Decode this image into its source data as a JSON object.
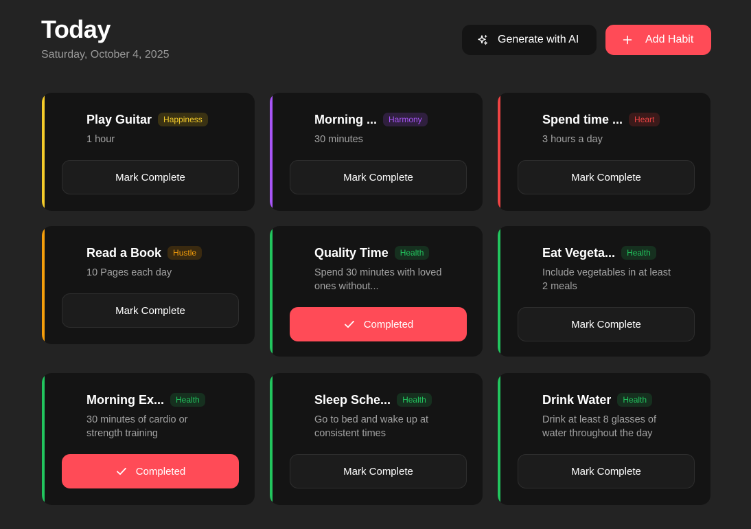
{
  "header": {
    "title": "Today",
    "date": "Saturday, October 4, 2025"
  },
  "actions": {
    "ai_label": "Generate with AI",
    "ai_icon": "sparkles-icon",
    "add_label": "Add Habit",
    "add_icon": "plus-icon"
  },
  "colors": {
    "background": "#232323",
    "card": "#141414",
    "accent_red": "#ff4b57",
    "happiness": "#f5cc2a",
    "harmony": "#a855f7",
    "heart": "#ef4444",
    "hustle": "#f59e0b",
    "health": "#22c55e"
  },
  "habits": [
    {
      "title": "Play Guitar",
      "category": "Happiness",
      "description": "1 hour",
      "status": "Mark Complete"
    },
    {
      "title": "Morning ...",
      "category": "Harmony",
      "description": "30 minutes",
      "status": "Mark Complete"
    },
    {
      "title": "Spend time ...",
      "category": "Heart",
      "description": "3 hours a day",
      "status": "Mark Complete"
    },
    {
      "title": "Read a Book",
      "category": "Hustle",
      "description": "10 Pages each day",
      "status": "Mark Complete"
    },
    {
      "title": "Quality Time",
      "category": "Health",
      "description": "Spend 30 minutes with loved ones without...",
      "status": "Completed"
    },
    {
      "title": "Eat Vegeta...",
      "category": "Health",
      "description": "Include vegetables in at least 2 meals",
      "status": "Mark Complete"
    },
    {
      "title": "Morning Ex...",
      "category": "Health",
      "description": "30 minutes of cardio or strength training",
      "status": "Completed"
    },
    {
      "title": "Sleep Sche...",
      "category": "Health",
      "description": "Go to bed and wake up at consistent times",
      "status": "Mark Complete"
    },
    {
      "title": "Drink Water",
      "category": "Health",
      "description": "Drink at least 8 glasses of water throughout the day",
      "status": "Mark Complete"
    }
  ]
}
